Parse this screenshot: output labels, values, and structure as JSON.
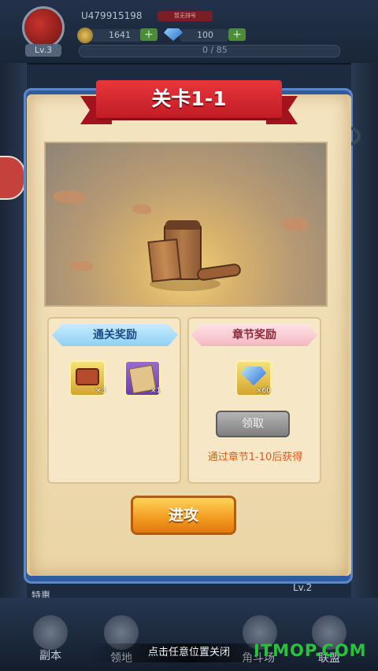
{
  "player": {
    "uid": "U479915198",
    "rank_tag": "暂无排号",
    "level": "Lv.3",
    "coins": "1641",
    "gems": "100",
    "exp": "0 / 85"
  },
  "modal": {
    "title": "关卡1-1",
    "clear_rewards": {
      "label": "通关奖励",
      "items": [
        {
          "icon": "treasure-chest-icon",
          "qty": "×3"
        },
        {
          "icon": "scroll-map-icon",
          "qty": "×1"
        }
      ]
    },
    "chapter_rewards": {
      "label": "章节奖励",
      "items": [
        {
          "icon": "blue-gem-icon",
          "qty": "×60"
        }
      ],
      "claim_button": "领取",
      "claim_note": "通过章节1-10后获得"
    },
    "attack_button": "进攻"
  },
  "background": {
    "side_labels": [
      "特惠",
      "Lv.2"
    ],
    "nav": [
      "副本",
      "领地",
      "角斗场",
      "联盟"
    ]
  },
  "close_hint": "点击任意位置关闭",
  "watermark": "ITMOP.COM"
}
